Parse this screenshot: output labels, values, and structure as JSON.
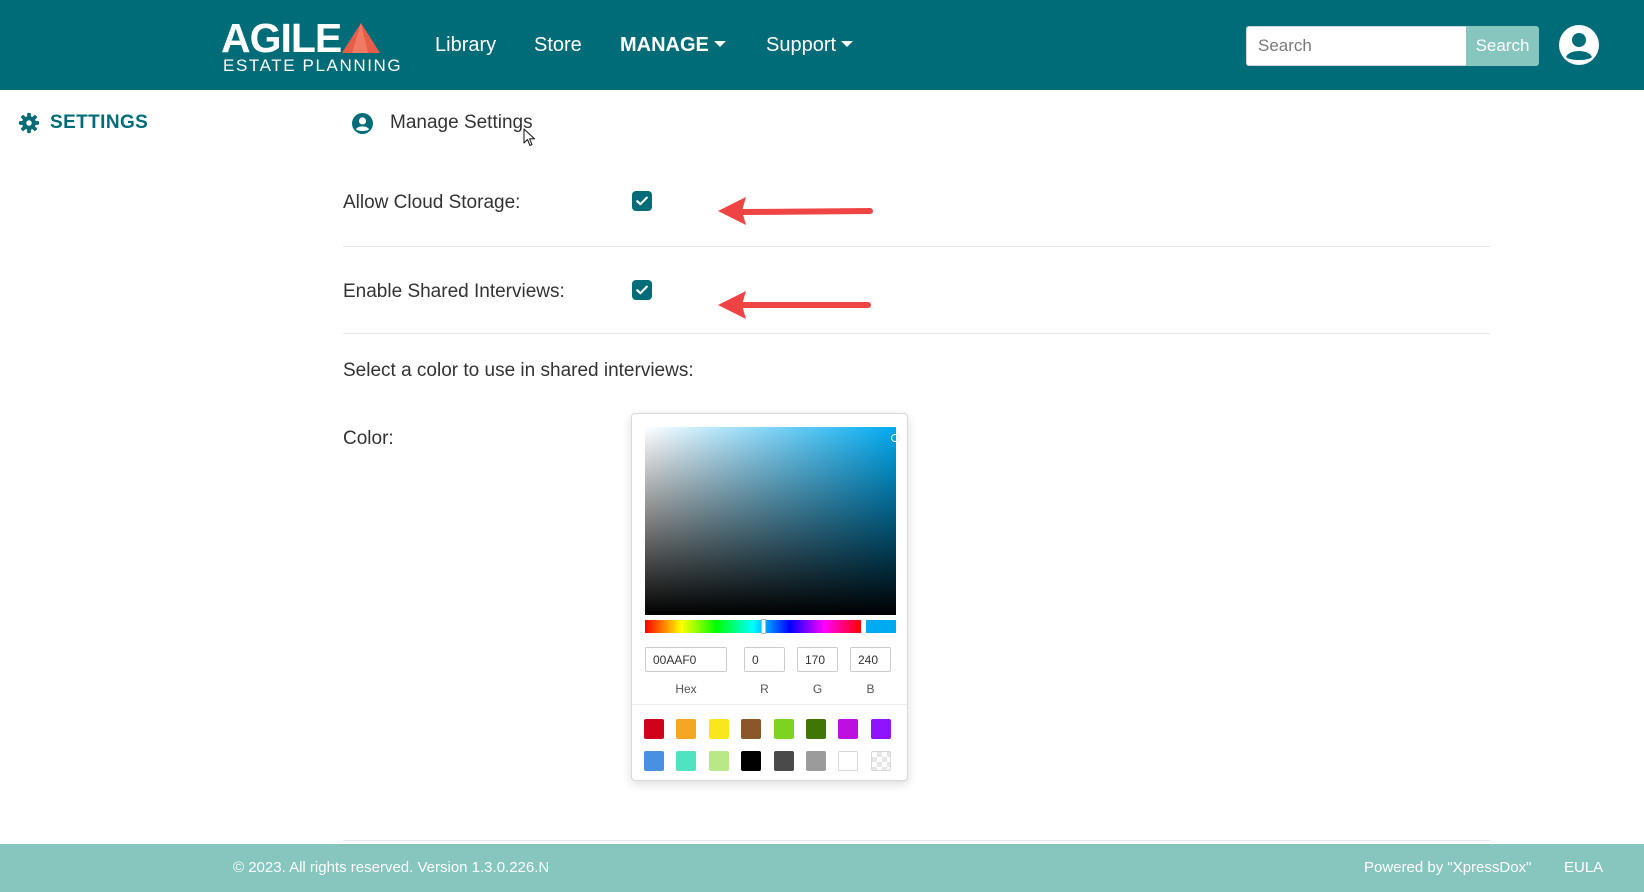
{
  "navbar": {
    "logo_main": "AGILE",
    "logo_sub": "ESTATE PLANNING",
    "menu": [
      {
        "label": "Library",
        "has_dropdown": false
      },
      {
        "label": "Store",
        "has_dropdown": false
      },
      {
        "label": "MANAGE",
        "has_dropdown": true,
        "active": true
      },
      {
        "label": "Support",
        "has_dropdown": true
      }
    ],
    "search_placeholder": "Search",
    "search_button": "Search",
    "user_icon": "user-circle-icon"
  },
  "sidebar": {
    "title": "SETTINGS",
    "icon": "gear-icon"
  },
  "main": {
    "title": "Manage Settings",
    "title_icon": "user-circle-icon",
    "settings": [
      {
        "label": "Allow Cloud Storage:",
        "checked": true
      },
      {
        "label": "Enable Shared Interviews:",
        "checked": true
      }
    ],
    "color_prompt": "Select a color to use in shared interviews:",
    "color_label": "Color:"
  },
  "color_picker": {
    "hex": "00AAF0",
    "r": "0",
    "g": "170",
    "b": "240",
    "labels": {
      "hex": "Hex",
      "r": "R",
      "g": "G",
      "b": "B"
    },
    "swatches": [
      "#d0021b",
      "#f5a623",
      "#f8e71c",
      "#8b572a",
      "#7ed321",
      "#417505",
      "#bd10e0",
      "#9013fe",
      "#4a90e2",
      "#50e3c2",
      "#b8e986",
      "#000000",
      "#4a4a4a",
      "#9b9b9b",
      "#ffffff",
      "transparent"
    ]
  },
  "footer": {
    "copyright": "© 2023. All rights reserved. Version 1.3.0.226.N",
    "powered_by": "Powered by \"XpressDox\"",
    "eula": "EULA"
  },
  "colors": {
    "brand": "#006c78",
    "footer": "#86c6bf",
    "annotation_arrow": "#ef4444"
  }
}
